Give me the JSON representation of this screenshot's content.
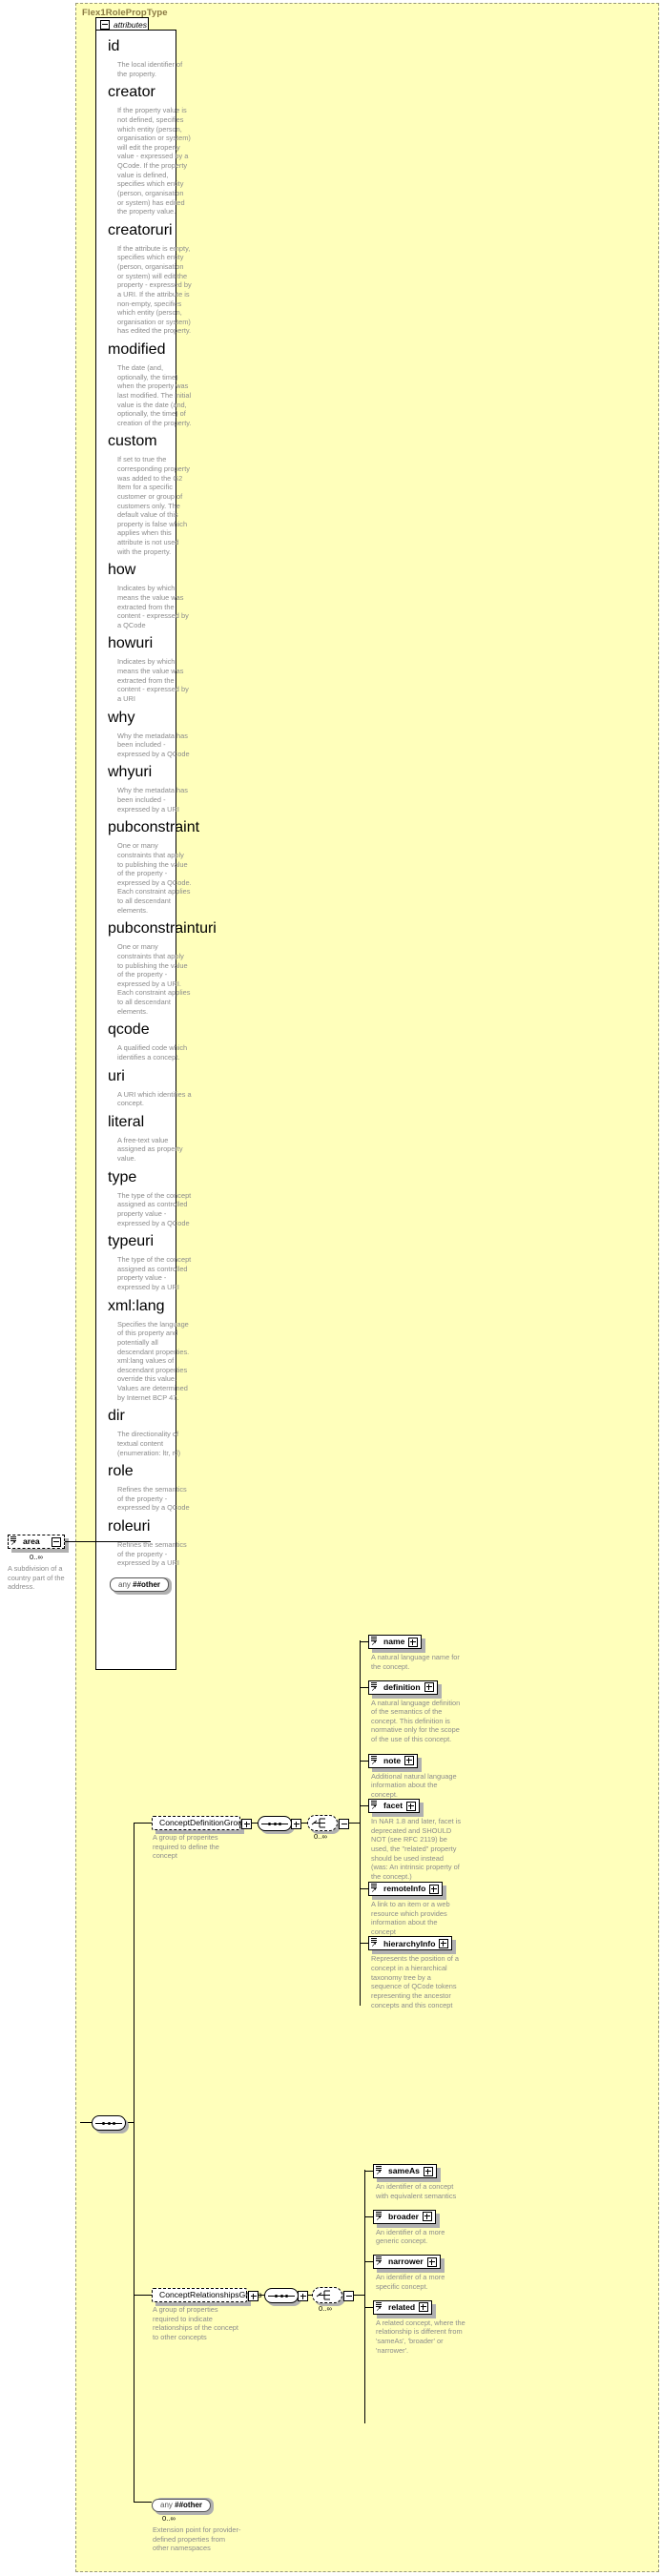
{
  "diagram": {
    "type_name": "Flex1RolePropType",
    "attributes_tab_label": "attributes",
    "colors": {
      "panel_bg": "#ffffbb",
      "box_bg": "#ffffff",
      "text": "#000000",
      "desc_text": "#8c8c8c",
      "title": "#8a7a43"
    }
  },
  "left_element": {
    "name": "area",
    "occurrence": "0..∞",
    "description": "A subdivision of a country part of the address."
  },
  "attributes": [
    {
      "name": "id",
      "description": "The local identifier of the property."
    },
    {
      "name": "creator",
      "description": "If the property value is not defined, specifies which entity (person, organisation or system) will edit the property value - expressed by a QCode. If the property value is defined, specifies which entity (person, organisation or system) has edited the property value."
    },
    {
      "name": "creatoruri",
      "description": "If the attribute is empty, specifies which entity (person, organisation or system) will edit the property - expressed by a URI. If the attribute is non-empty, specifies which entity (person, organisation or system) has edited the property."
    },
    {
      "name": "modified",
      "description": "The date (and, optionally, the time) when the property was last modified. The initial value is the date (and, optionally, the time) of creation of the property."
    },
    {
      "name": "custom",
      "description": "If set to true the corresponding property was added to the G2 Item for a specific customer or group of customers only. The default value of this property is false which applies when this attribute is not used with the property."
    },
    {
      "name": "how",
      "description": "Indicates by which means the value was extracted from the content - expressed by a QCode"
    },
    {
      "name": "howuri",
      "description": "Indicates by which means the value was extracted from the content - expressed by a URI"
    },
    {
      "name": "why",
      "description": "Why the metadata has been included - expressed by a QCode"
    },
    {
      "name": "whyuri",
      "description": "Why the metadata has been included - expressed by a URI"
    },
    {
      "name": "pubconstraint",
      "description": "One or many constraints that apply to publishing the value of the property - expressed by a QCode. Each constraint applies to all descendant elements."
    },
    {
      "name": "pubconstrainturi",
      "description": "One or many constraints that apply to publishing the value of the property - expressed by a URI. Each constraint applies to all descendant elements."
    },
    {
      "name": "qcode",
      "description": "A qualified code which identifies a concept."
    },
    {
      "name": "uri",
      "description": "A URI which identifies a concept."
    },
    {
      "name": "literal",
      "description": "A free-text value assigned as property value."
    },
    {
      "name": "type",
      "description": "The type of the concept assigned as controlled property value - expressed by a QCode"
    },
    {
      "name": "typeuri",
      "description": "The type of the concept assigned as controlled property value - expressed by a URI"
    },
    {
      "name": "xml:lang",
      "description": "Specifies the language of this property and potentially all descendant properties. xml:lang values of descendant properties override this value. Values are determined by Internet BCP 47."
    },
    {
      "name": "dir",
      "description": "The directionality of textual content (enumeration: ltr, rtl)"
    },
    {
      "name": "role",
      "description": "Refines the semantics of the property - expressed by a QCode"
    },
    {
      "name": "roleuri",
      "description": "Refines the semantics of the property - expressed by a URI"
    }
  ],
  "attributes_any": {
    "label_prefix": "any ",
    "label_bold": "##other"
  },
  "groups": [
    {
      "name": "ConceptDefinitionGroup",
      "description": "A group of properites required to define the concept",
      "occurrence": "0..∞",
      "children": [
        {
          "name": "name",
          "description": "A natural language name for the concept."
        },
        {
          "name": "definition",
          "description": "A natural language definition of the semantics of the concept. This definition is normative only for the scope of the use of this concept."
        },
        {
          "name": "note",
          "description": "Additional natural language information about the concept."
        },
        {
          "name": "facet",
          "description": "In NAR 1.8 and later, facet is deprecated and SHOULD NOT (see RFC 2119) be used, the \"related\" property should be used instead (was: An intrinsic property of the concept.)"
        },
        {
          "name": "remoteInfo",
          "description": "A link to an item or a web resource which provides information about the concept"
        },
        {
          "name": "hierarchyInfo",
          "description": "Represents the position of a concept in a hierarchical taxonomy tree by a sequence of QCode tokens representing the ancestor concepts and this concept"
        }
      ]
    },
    {
      "name": "ConceptRelationshipsGroup",
      "description": "A group of properties required to indicate relationships of the concept to other concepts",
      "occurrence": "0..∞",
      "children": [
        {
          "name": "sameAs",
          "description": "An identifier of a concept with equivalent semantics"
        },
        {
          "name": "broader",
          "description": "An identifier of a more generic concept."
        },
        {
          "name": "narrower",
          "description": "An identifier of a more specific concept."
        },
        {
          "name": "related",
          "description": "A related concept, where the relationship is different from 'sameAs', 'broader' or 'narrower'."
        }
      ]
    }
  ],
  "content_any": {
    "label_prefix": "any ",
    "label_bold": "##other",
    "occurrence": "0..∞",
    "description": "Extension point for provider-defined properties from other namespaces"
  }
}
